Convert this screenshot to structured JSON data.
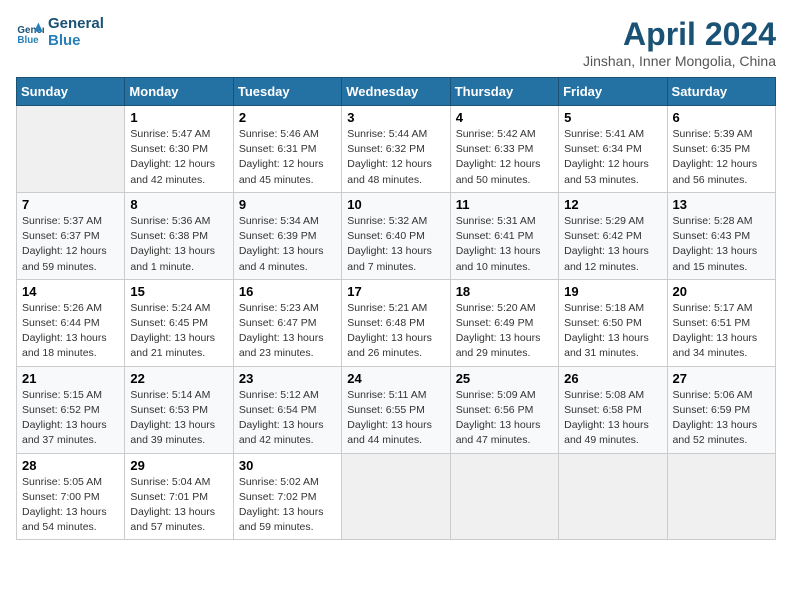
{
  "header": {
    "logo_line1": "General",
    "logo_line2": "Blue",
    "month": "April 2024",
    "location": "Jinshan, Inner Mongolia, China"
  },
  "weekdays": [
    "Sunday",
    "Monday",
    "Tuesday",
    "Wednesday",
    "Thursday",
    "Friday",
    "Saturday"
  ],
  "weeks": [
    [
      {
        "day": "",
        "info": ""
      },
      {
        "day": "1",
        "info": "Sunrise: 5:47 AM\nSunset: 6:30 PM\nDaylight: 12 hours\nand 42 minutes."
      },
      {
        "day": "2",
        "info": "Sunrise: 5:46 AM\nSunset: 6:31 PM\nDaylight: 12 hours\nand 45 minutes."
      },
      {
        "day": "3",
        "info": "Sunrise: 5:44 AM\nSunset: 6:32 PM\nDaylight: 12 hours\nand 48 minutes."
      },
      {
        "day": "4",
        "info": "Sunrise: 5:42 AM\nSunset: 6:33 PM\nDaylight: 12 hours\nand 50 minutes."
      },
      {
        "day": "5",
        "info": "Sunrise: 5:41 AM\nSunset: 6:34 PM\nDaylight: 12 hours\nand 53 minutes."
      },
      {
        "day": "6",
        "info": "Sunrise: 5:39 AM\nSunset: 6:35 PM\nDaylight: 12 hours\nand 56 minutes."
      }
    ],
    [
      {
        "day": "7",
        "info": "Sunrise: 5:37 AM\nSunset: 6:37 PM\nDaylight: 12 hours\nand 59 minutes."
      },
      {
        "day": "8",
        "info": "Sunrise: 5:36 AM\nSunset: 6:38 PM\nDaylight: 13 hours\nand 1 minute."
      },
      {
        "day": "9",
        "info": "Sunrise: 5:34 AM\nSunset: 6:39 PM\nDaylight: 13 hours\nand 4 minutes."
      },
      {
        "day": "10",
        "info": "Sunrise: 5:32 AM\nSunset: 6:40 PM\nDaylight: 13 hours\nand 7 minutes."
      },
      {
        "day": "11",
        "info": "Sunrise: 5:31 AM\nSunset: 6:41 PM\nDaylight: 13 hours\nand 10 minutes."
      },
      {
        "day": "12",
        "info": "Sunrise: 5:29 AM\nSunset: 6:42 PM\nDaylight: 13 hours\nand 12 minutes."
      },
      {
        "day": "13",
        "info": "Sunrise: 5:28 AM\nSunset: 6:43 PM\nDaylight: 13 hours\nand 15 minutes."
      }
    ],
    [
      {
        "day": "14",
        "info": "Sunrise: 5:26 AM\nSunset: 6:44 PM\nDaylight: 13 hours\nand 18 minutes."
      },
      {
        "day": "15",
        "info": "Sunrise: 5:24 AM\nSunset: 6:45 PM\nDaylight: 13 hours\nand 21 minutes."
      },
      {
        "day": "16",
        "info": "Sunrise: 5:23 AM\nSunset: 6:47 PM\nDaylight: 13 hours\nand 23 minutes."
      },
      {
        "day": "17",
        "info": "Sunrise: 5:21 AM\nSunset: 6:48 PM\nDaylight: 13 hours\nand 26 minutes."
      },
      {
        "day": "18",
        "info": "Sunrise: 5:20 AM\nSunset: 6:49 PM\nDaylight: 13 hours\nand 29 minutes."
      },
      {
        "day": "19",
        "info": "Sunrise: 5:18 AM\nSunset: 6:50 PM\nDaylight: 13 hours\nand 31 minutes."
      },
      {
        "day": "20",
        "info": "Sunrise: 5:17 AM\nSunset: 6:51 PM\nDaylight: 13 hours\nand 34 minutes."
      }
    ],
    [
      {
        "day": "21",
        "info": "Sunrise: 5:15 AM\nSunset: 6:52 PM\nDaylight: 13 hours\nand 37 minutes."
      },
      {
        "day": "22",
        "info": "Sunrise: 5:14 AM\nSunset: 6:53 PM\nDaylight: 13 hours\nand 39 minutes."
      },
      {
        "day": "23",
        "info": "Sunrise: 5:12 AM\nSunset: 6:54 PM\nDaylight: 13 hours\nand 42 minutes."
      },
      {
        "day": "24",
        "info": "Sunrise: 5:11 AM\nSunset: 6:55 PM\nDaylight: 13 hours\nand 44 minutes."
      },
      {
        "day": "25",
        "info": "Sunrise: 5:09 AM\nSunset: 6:56 PM\nDaylight: 13 hours\nand 47 minutes."
      },
      {
        "day": "26",
        "info": "Sunrise: 5:08 AM\nSunset: 6:58 PM\nDaylight: 13 hours\nand 49 minutes."
      },
      {
        "day": "27",
        "info": "Sunrise: 5:06 AM\nSunset: 6:59 PM\nDaylight: 13 hours\nand 52 minutes."
      }
    ],
    [
      {
        "day": "28",
        "info": "Sunrise: 5:05 AM\nSunset: 7:00 PM\nDaylight: 13 hours\nand 54 minutes."
      },
      {
        "day": "29",
        "info": "Sunrise: 5:04 AM\nSunset: 7:01 PM\nDaylight: 13 hours\nand 57 minutes."
      },
      {
        "day": "30",
        "info": "Sunrise: 5:02 AM\nSunset: 7:02 PM\nDaylight: 13 hours\nand 59 minutes."
      },
      {
        "day": "",
        "info": ""
      },
      {
        "day": "",
        "info": ""
      },
      {
        "day": "",
        "info": ""
      },
      {
        "day": "",
        "info": ""
      }
    ]
  ]
}
